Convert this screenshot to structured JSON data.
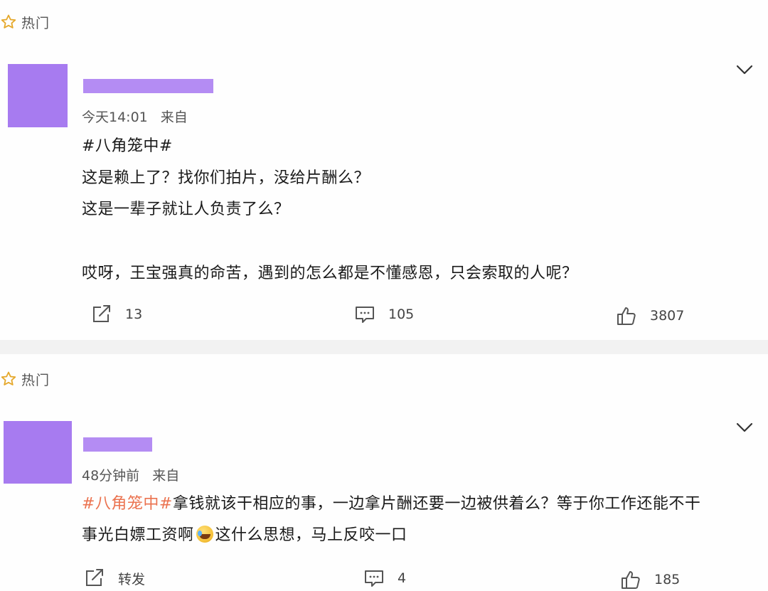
{
  "posts": [
    {
      "hot_label": "热门",
      "time": "今天14:01",
      "source": "来自",
      "topic": "#八角笼中#",
      "lines": [
        "这是赖上了？找你们拍片，没给片酬么？",
        "这是一辈子就让人负责了么？",
        "哎呀，王宝强真的命苦，遇到的怎么都是不懂感恩，只会索取的人呢？"
      ],
      "actions": {
        "repost": "13",
        "comment": "105",
        "like": "3807"
      }
    },
    {
      "hot_label": "热门",
      "time": "48分钟前",
      "source": "来自",
      "topic": "#八角笼中#",
      "line1_rest": "拿钱就该干相应的事，一边拿片酬还要一边被供着么？等于你工作还能不干",
      "line2_a": "事光白嫖工资啊",
      "line2_b": "这什么思想，马上反咬一口",
      "actions": {
        "repost": "转发",
        "comment": "4",
        "like": "185"
      }
    }
  ],
  "colors": {
    "accent_topic": "#eb7350",
    "avatar_redaction": "#a77bf0",
    "name_redaction": "#b48cf3",
    "separator": "#f2f2f2"
  },
  "icons": [
    "star-outline-icon",
    "chevron-down-icon",
    "repost-icon",
    "comment-icon",
    "like-icon",
    "laughing-crying-emoji"
  ]
}
